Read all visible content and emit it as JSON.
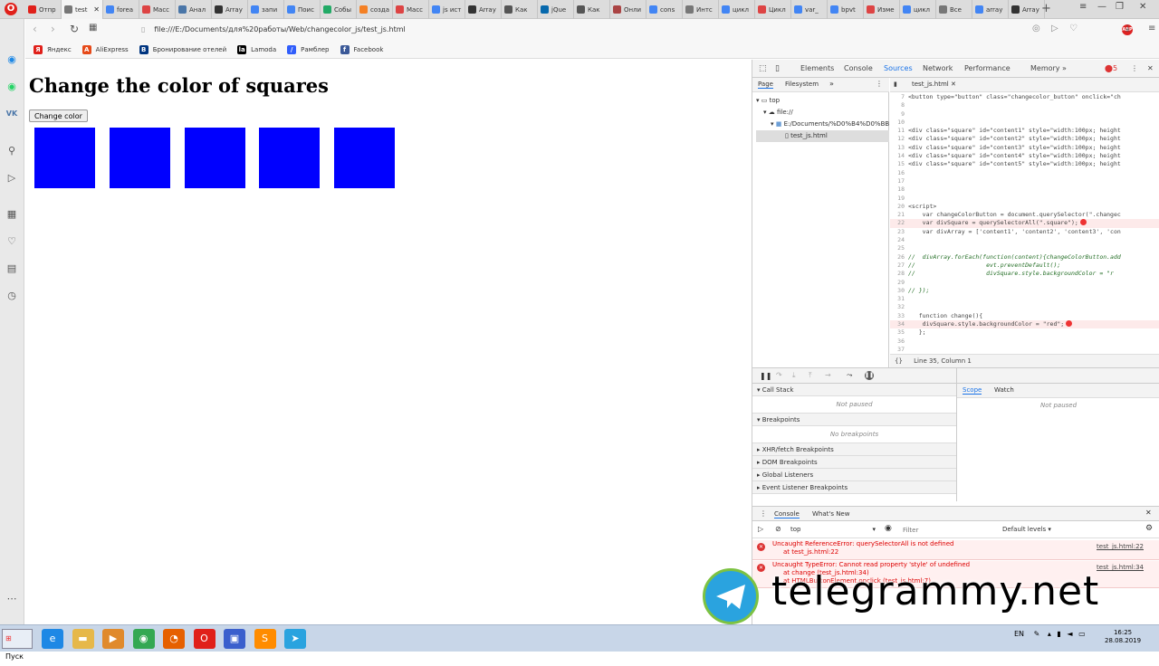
{
  "browser": {
    "tabs": [
      {
        "label": "Отпр",
        "icon": "opera-mail-icon",
        "color": "#e0201a"
      },
      {
        "label": "test",
        "icon": "page-icon",
        "color": "#777777",
        "active": true
      },
      {
        "label": "forea",
        "icon": "google-icon",
        "color": "#4285f4"
      },
      {
        "label": "Масс",
        "icon": "learn-icon",
        "color": "#d44"
      },
      {
        "label": "Анал",
        "icon": "habr-icon",
        "color": "#4a76a8"
      },
      {
        "label": "Array",
        "icon": "mdn-icon",
        "color": "#333"
      },
      {
        "label": "запи",
        "icon": "google-icon",
        "color": "#4285f4"
      },
      {
        "label": "Поис",
        "icon": "google-icon",
        "color": "#4285f4"
      },
      {
        "label": "Собы",
        "icon": "js-icon",
        "color": "#2a6"
      },
      {
        "label": "созда",
        "icon": "stack-icon",
        "color": "#f48024"
      },
      {
        "label": "Масс",
        "icon": "learn-icon",
        "color": "#d44"
      },
      {
        "label": "js ист",
        "icon": "google-icon",
        "color": "#4285f4"
      },
      {
        "label": "Array",
        "icon": "mdn-icon",
        "color": "#333"
      },
      {
        "label": "Как",
        "icon": "k-icon",
        "color": "#555"
      },
      {
        "label": "jQue",
        "icon": "jquery-icon",
        "color": "#0769ad"
      },
      {
        "label": "Как",
        "icon": "k-icon",
        "color": "#555"
      },
      {
        "label": "Онли",
        "icon": "online-icon",
        "color": "#a44"
      },
      {
        "label": "cons",
        "icon": "google-icon",
        "color": "#4285f4"
      },
      {
        "label": "Интс",
        "icon": "page-icon",
        "color": "#777"
      },
      {
        "label": "цикл",
        "icon": "google-icon",
        "color": "#4285f4"
      },
      {
        "label": "Цикл",
        "icon": "learn-icon",
        "color": "#d44"
      },
      {
        "label": "var_",
        "icon": "google-icon",
        "color": "#4285f4"
      },
      {
        "label": "bpvt",
        "icon": "google-icon",
        "color": "#4285f4"
      },
      {
        "label": "Изме",
        "icon": "learn-icon",
        "color": "#d44"
      },
      {
        "label": "цикл",
        "icon": "google-icon",
        "color": "#4285f4"
      },
      {
        "label": "Все",
        "icon": "page-icon",
        "color": "#777"
      },
      {
        "label": "array",
        "icon": "google-icon",
        "color": "#4285f4"
      },
      {
        "label": "Array",
        "icon": "mdn-icon",
        "color": "#333"
      }
    ],
    "url": "file:///E:/Documents/для%20работы/Web/changecolor_js/test_js.html",
    "bookmarks": [
      {
        "label": "Яндекс",
        "icon_text": "Я",
        "color": "#e0201a"
      },
      {
        "label": "AliExpress",
        "icon_text": "A",
        "color": "#e64a19"
      },
      {
        "label": "Бронирование отелей",
        "icon_text": "B",
        "color": "#003580"
      },
      {
        "label": "Lamoda",
        "icon_text": "la",
        "color": "#000000"
      },
      {
        "label": "Рамблер",
        "icon_text": "/",
        "color": "#315efb"
      },
      {
        "label": "Facebook",
        "icon_text": "f",
        "color": "#3b5998"
      }
    ]
  },
  "page": {
    "heading": "Change the color of squares",
    "button_label": "Change color",
    "square_color": "#0000ff",
    "square_ids": [
      "content1",
      "content2",
      "content3",
      "content4",
      "content5"
    ]
  },
  "devtools": {
    "tabs": [
      "Elements",
      "Console",
      "Sources",
      "Network",
      "Performance",
      "Memory"
    ],
    "active_tab": "Sources",
    "error_count": "5",
    "nav_tabs": [
      "Page",
      "Filesystem"
    ],
    "tree": [
      "top",
      "file://",
      "E:/Documents/%D0%B4%D0%BB",
      "test_js.html"
    ],
    "file_tab": "test_js.html",
    "code_lines": [
      {
        "n": "7",
        "t": "<button type=\"button\" class=\"changecolor_button\" onclick=\"ch"
      },
      {
        "n": "8",
        "t": ""
      },
      {
        "n": "9",
        "t": ""
      },
      {
        "n": "10",
        "t": ""
      },
      {
        "n": "11",
        "t": "<div class=\"square\" id=\"content1\" style=\"width:100px; height"
      },
      {
        "n": "12",
        "t": "<div class=\"square\" id=\"content2\" style=\"width:100px; height"
      },
      {
        "n": "13",
        "t": "<div class=\"square\" id=\"content3\" style=\"width:100px; height"
      },
      {
        "n": "14",
        "t": "<div class=\"square\" id=\"content4\" style=\"width:100px; height"
      },
      {
        "n": "15",
        "t": "<div class=\"square\" id=\"content5\" style=\"width:100px; height"
      },
      {
        "n": "16",
        "t": ""
      },
      {
        "n": "17",
        "t": ""
      },
      {
        "n": "18",
        "t": ""
      },
      {
        "n": "19",
        "t": ""
      },
      {
        "n": "20",
        "t": "<script>"
      },
      {
        "n": "21",
        "t": "    var changeColorButton = document.querySelector(\".changec"
      },
      {
        "n": "22",
        "t": "    var divSquare = querySelectorAll(\".square\");",
        "err": true
      },
      {
        "n": "23",
        "t": "    var divArray = ['content1', 'content2', 'content3', 'con"
      },
      {
        "n": "24",
        "t": ""
      },
      {
        "n": "25",
        "t": ""
      },
      {
        "n": "26",
        "t": "//  divArray.forEach(function(content){changeColorButton.add"
      },
      {
        "n": "27",
        "t": "//                    evt.preventDefault();"
      },
      {
        "n": "28",
        "t": "//                    divSquare.style.backgroundColor = \"r"
      },
      {
        "n": "29",
        "t": ""
      },
      {
        "n": "30",
        "t": "// });"
      },
      {
        "n": "31",
        "t": ""
      },
      {
        "n": "32",
        "t": ""
      },
      {
        "n": "33",
        "t": "   function change(){"
      },
      {
        "n": "34",
        "t": "    divSquare.style.backgroundColor = \"red\";",
        "err": true
      },
      {
        "n": "35",
        "t": "   };"
      },
      {
        "n": "36",
        "t": ""
      },
      {
        "n": "37",
        "t": ""
      }
    ],
    "status": "Line 35, Column 1",
    "sections": {
      "call_stack": "Call Stack",
      "not_paused": "Not paused",
      "breakpoints": "Breakpoints",
      "no_breakpoints": "No breakpoints",
      "xhr": "XHR/fetch Breakpoints",
      "dom": "DOM Breakpoints",
      "global": "Global Listeners",
      "event": "Event Listener Breakpoints"
    },
    "scope_tabs": [
      "Scope",
      "Watch"
    ],
    "scope_msg": "Not paused",
    "console": {
      "tabs": [
        "Console",
        "What's New"
      ],
      "context": "top",
      "filter_placeholder": "Filter",
      "levels": "Default levels",
      "errors": [
        {
          "msg": "Uncaught ReferenceError: querySelectorAll is not defined",
          "at": "at test_js.html:22",
          "src": "test_js.html:22"
        },
        {
          "msg": "Uncaught TypeError: Cannot read property 'style' of undefined",
          "at": "at change (test_js.html:34)",
          "at2": "at HTMLButtonElement.onclick (test_js.html:7)",
          "src": "test_js.html:34"
        }
      ]
    }
  },
  "watermark": "telegrammy.net",
  "taskbar": {
    "start": "Пуск",
    "apps": [
      {
        "name": "ie-icon",
        "glyph": "e",
        "color": "#1e88e5"
      },
      {
        "name": "folder-icon",
        "glyph": "▬",
        "color": "#e6b84a"
      },
      {
        "name": "media-player-icon",
        "glyph": "▶",
        "color": "#e08a2c"
      },
      {
        "name": "chrome-icon",
        "glyph": "◉",
        "color": "#34a853"
      },
      {
        "name": "firefox-icon",
        "glyph": "◔",
        "color": "#e66000"
      },
      {
        "name": "opera-icon",
        "glyph": "O",
        "color": "#e0201a"
      },
      {
        "name": "save-icon",
        "glyph": "▣",
        "color": "#3a5fcd"
      },
      {
        "name": "sublime-icon",
        "glyph": "S",
        "color": "#ff8c00"
      },
      {
        "name": "telegram-icon",
        "glyph": "➤",
        "color": "#2aa3df"
      }
    ],
    "lang": "EN",
    "time": "16:25",
    "date": "28.08.2019"
  }
}
